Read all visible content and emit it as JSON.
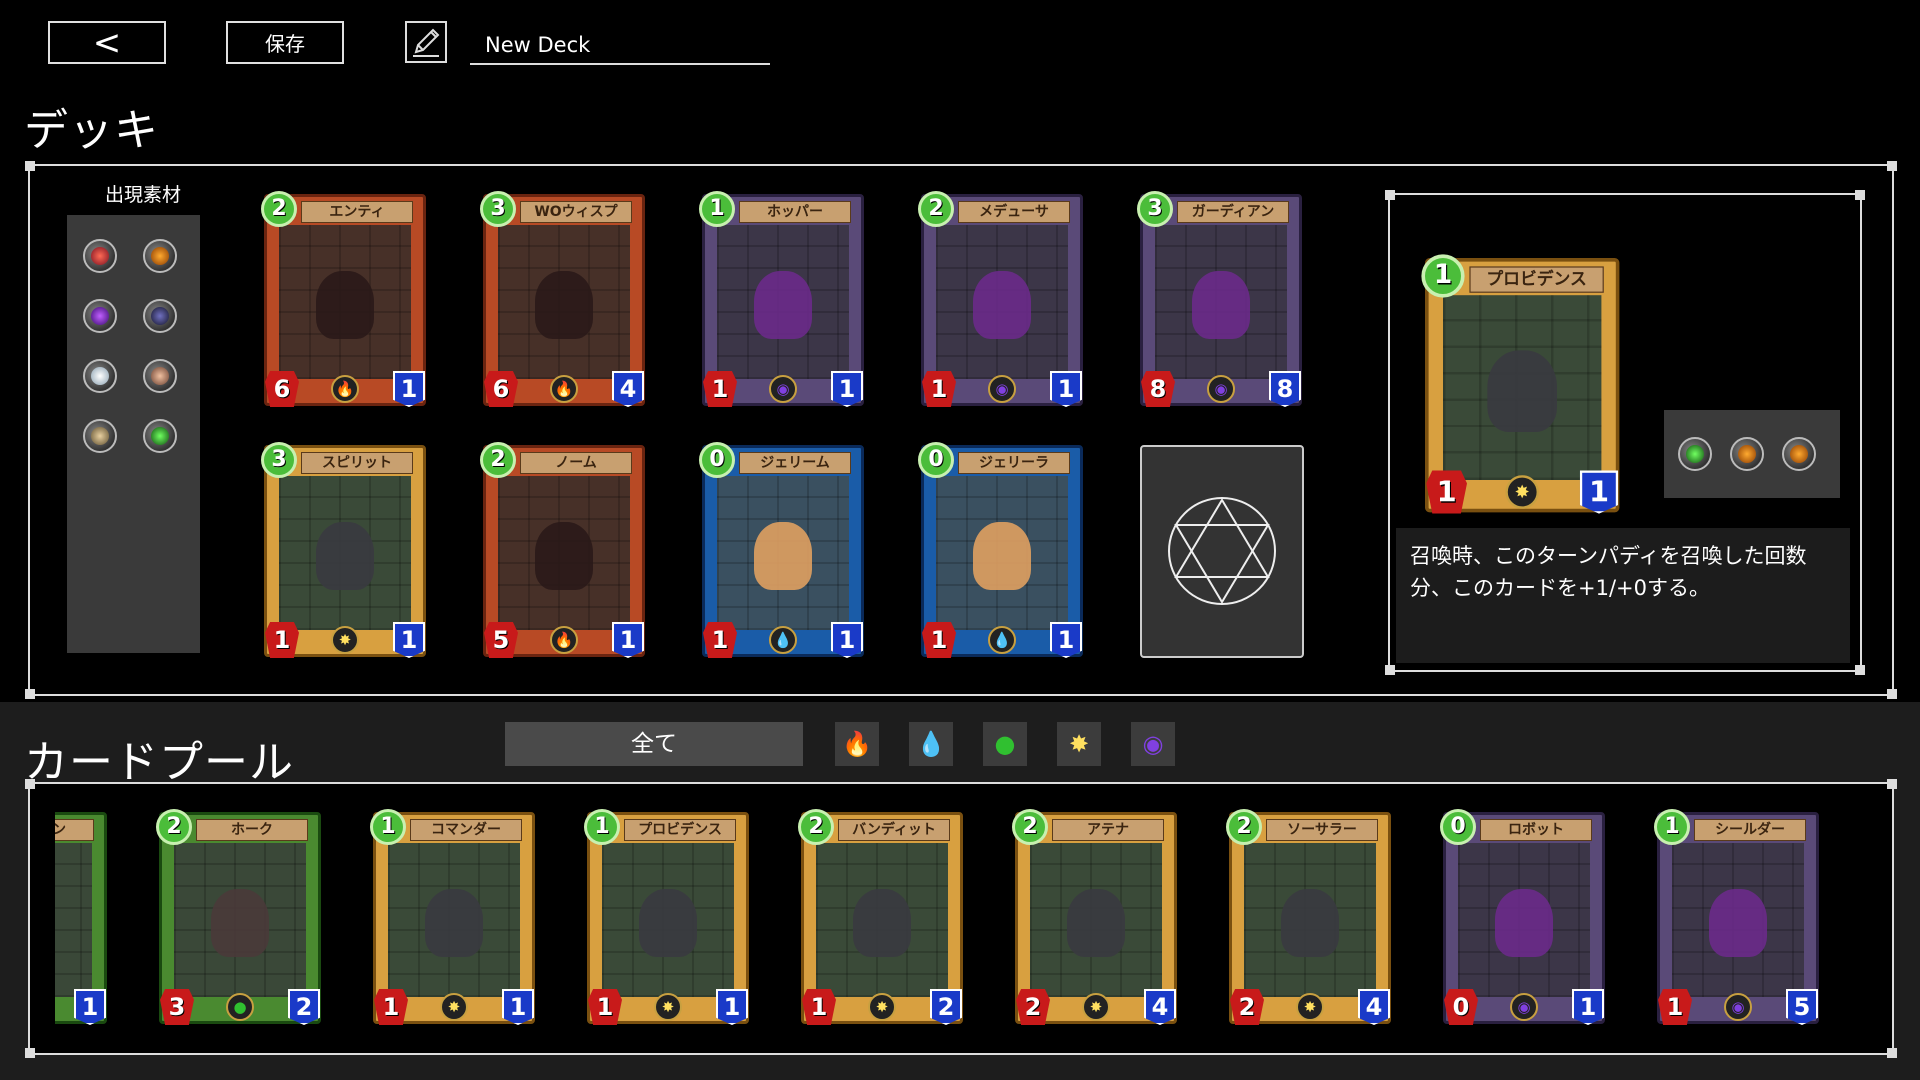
{
  "toolbar": {
    "back_label": "<",
    "save_label": "保存",
    "deck_name": "New Deck"
  },
  "deck": {
    "title": "デッキ",
    "materials_label": "出現素材",
    "materials": [
      "red",
      "orange",
      "purple",
      "dark",
      "white",
      "tan",
      "beige",
      "green"
    ],
    "cards": [
      {
        "name": "エンティ",
        "cost": "2",
        "atk": "6",
        "hp": "1",
        "element": "fire",
        "frame": "red"
      },
      {
        "name": "WOウィスプ",
        "cost": "3",
        "atk": "6",
        "hp": "4",
        "element": "fire",
        "frame": "red"
      },
      {
        "name": "ホッパー",
        "cost": "1",
        "atk": "1",
        "hp": "1",
        "element": "dark",
        "frame": "purple"
      },
      {
        "name": "メデューサ",
        "cost": "2",
        "atk": "1",
        "hp": "1",
        "element": "dark",
        "frame": "purple"
      },
      {
        "name": "ガーディアン",
        "cost": "3",
        "atk": "8",
        "hp": "8",
        "element": "dark",
        "frame": "purple"
      },
      {
        "name": "スピリット",
        "cost": "3",
        "atk": "1",
        "hp": "1",
        "element": "light",
        "frame": "gold"
      },
      {
        "name": "ノーム",
        "cost": "2",
        "atk": "5",
        "hp": "1",
        "element": "fire",
        "frame": "red"
      },
      {
        "name": "ジェリーム",
        "cost": "0",
        "atk": "1",
        "hp": "1",
        "element": "water",
        "frame": "blue"
      },
      {
        "name": "ジェリーラ",
        "cost": "0",
        "atk": "1",
        "hp": "1",
        "element": "water",
        "frame": "blue"
      }
    ]
  },
  "detail": {
    "card": {
      "name": "プロビデンス",
      "cost": "1",
      "atk": "1",
      "hp": "1",
      "element": "light",
      "frame": "gold"
    },
    "materials": [
      "green",
      "orange",
      "orange"
    ],
    "description": "召喚時、このターンパディを召喚した回数分、このカードを+1/+0する。"
  },
  "pool": {
    "title": "カードプール",
    "filter_all": "全て",
    "filters": [
      {
        "icon": "fire-icon",
        "glyph": "🔥",
        "color": "#ff5020"
      },
      {
        "icon": "water-icon",
        "glyph": "💧",
        "color": "#40c0ff"
      },
      {
        "icon": "leaf-icon",
        "glyph": "●",
        "color": "#30c030"
      },
      {
        "icon": "light-icon",
        "glyph": "✸",
        "color": "#ffe060"
      },
      {
        "icon": "dark-icon",
        "glyph": "◉",
        "color": "#8040e0"
      }
    ],
    "cards": [
      {
        "name": "ルダイン",
        "cost": "",
        "atk": "",
        "hp": "1",
        "element": "leaf",
        "frame": "green"
      },
      {
        "name": "ホーク",
        "cost": "2",
        "atk": "3",
        "hp": "2",
        "element": "leaf",
        "frame": "green"
      },
      {
        "name": "コマンダー",
        "cost": "1",
        "atk": "1",
        "hp": "1",
        "element": "light",
        "frame": "gold"
      },
      {
        "name": "プロビデンス",
        "cost": "1",
        "atk": "1",
        "hp": "1",
        "element": "light",
        "frame": "gold"
      },
      {
        "name": "バンディット",
        "cost": "2",
        "atk": "1",
        "hp": "2",
        "element": "light",
        "frame": "gold"
      },
      {
        "name": "アテナ",
        "cost": "2",
        "atk": "2",
        "hp": "4",
        "element": "light",
        "frame": "gold"
      },
      {
        "name": "ソーサラー",
        "cost": "2",
        "atk": "2",
        "hp": "4",
        "element": "light",
        "frame": "gold"
      },
      {
        "name": "ロボット",
        "cost": "0",
        "atk": "0",
        "hp": "1",
        "element": "dark",
        "frame": "purple"
      },
      {
        "name": "シールダー",
        "cost": "1",
        "atk": "1",
        "hp": "5",
        "element": "dark",
        "frame": "purple"
      }
    ]
  },
  "element_glyphs": {
    "fire": "🔥",
    "water": "💧",
    "leaf": "●",
    "light": "✸",
    "dark": "◉"
  },
  "element_colors": {
    "fire": "#ff5020",
    "water": "#40c0ff",
    "leaf": "#30c030",
    "light": "#ffe060",
    "dark": "#8040e0"
  }
}
